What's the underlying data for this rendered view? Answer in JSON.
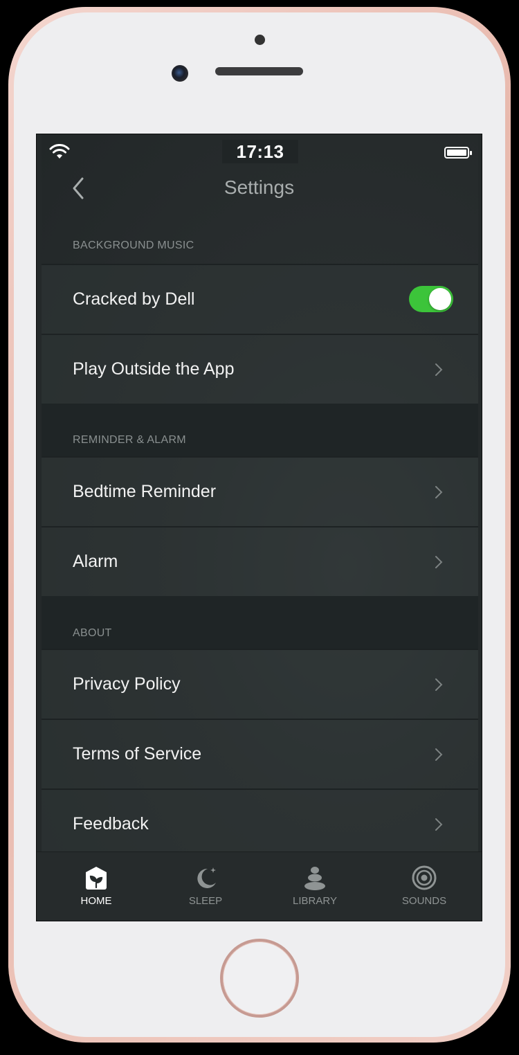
{
  "status_bar": {
    "time": "17:13"
  },
  "nav": {
    "title": "Settings"
  },
  "sections": [
    {
      "header": "BACKGROUND MUSIC",
      "rows": [
        {
          "label": "Cracked by Dell",
          "control": "toggle",
          "toggle_on": true
        },
        {
          "label": "Play Outside the App",
          "control": "chevron"
        }
      ]
    },
    {
      "header": "REMINDER & ALARM",
      "rows": [
        {
          "label": "Bedtime Reminder",
          "control": "chevron"
        },
        {
          "label": "Alarm",
          "control": "chevron"
        }
      ]
    },
    {
      "header": "ABOUT",
      "rows": [
        {
          "label": "Privacy Policy",
          "control": "chevron"
        },
        {
          "label": "Terms of Service",
          "control": "chevron"
        },
        {
          "label": "Feedback",
          "control": "chevron"
        }
      ]
    }
  ],
  "tabs": [
    {
      "label": "HOME",
      "icon": "home-icon",
      "active": true
    },
    {
      "label": "SLEEP",
      "icon": "moon-icon",
      "active": false
    },
    {
      "label": "LIBRARY",
      "icon": "stones-icon",
      "active": false
    },
    {
      "label": "SOUNDS",
      "icon": "speaker-icon",
      "active": false
    }
  ],
  "colors": {
    "toggle_on": "#3cc43a",
    "background": "#2a2f30",
    "tab_active": "#ffffff",
    "tab_inactive": "#8f9494"
  }
}
